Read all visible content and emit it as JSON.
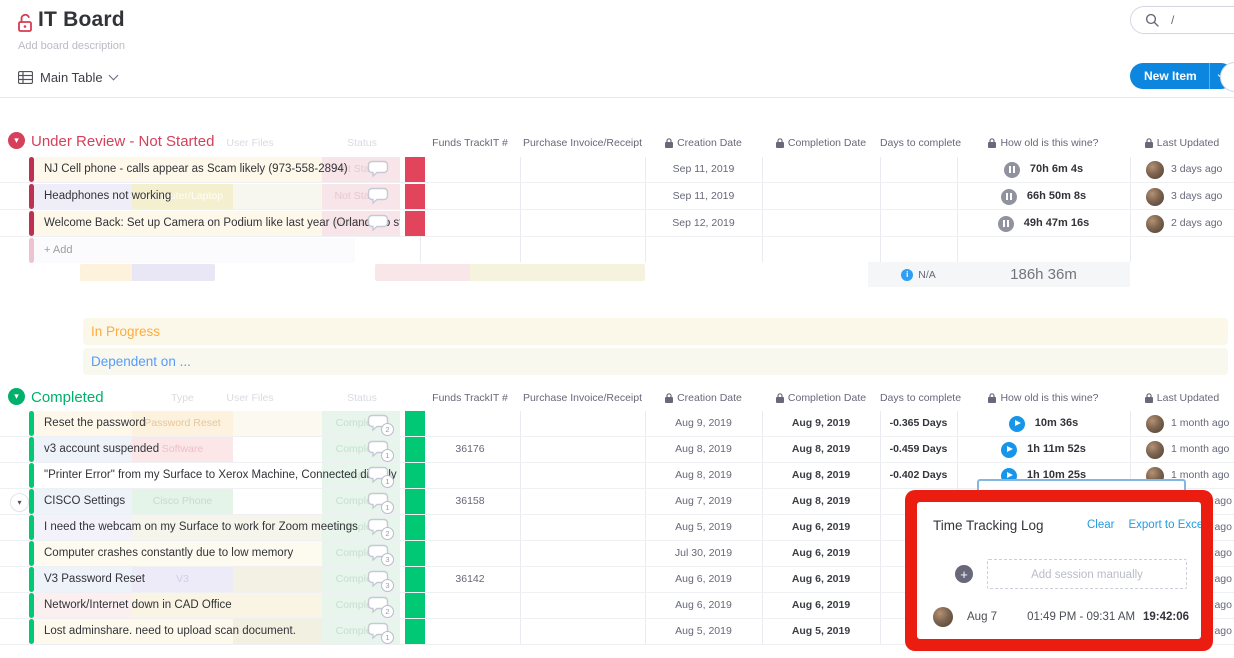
{
  "header": {
    "title": "IT Board",
    "description_placeholder": "Add board description",
    "view_tab": "Main Table",
    "new_item_label": "New Item",
    "search_shortcut": "/"
  },
  "columns": {
    "type": "Type",
    "user_files": "User Files",
    "status": "Status",
    "funds": "Funds TrackIT #",
    "purchase": "Purchase Invoice/Receipt",
    "creation": "Creation Date",
    "completion": "Completion Date",
    "days": "Days to complete",
    "wine": "How old is this wine?",
    "last_updated": "Last Updated"
  },
  "groups": [
    {
      "title": "Under Review - Not Started",
      "add_label": "+ Add",
      "rows": [
        {
          "name": "NJ Cell phone - calls appear as Scam likely (973-558-2894)",
          "status": "Not Started",
          "creation": "Sep 11, 2019",
          "wine": "70h 6m 4s",
          "updated": "3 days ago"
        },
        {
          "name": "Headphones not working",
          "type": "Computer/Laptop",
          "status": "Not Started",
          "creation": "Sep 11, 2019",
          "wine": "66h 50m 8s",
          "updated": "3 days ago"
        },
        {
          "name": "Welcome Back: Set up Camera on Podium like last year (Orlando to stay in Au...",
          "status": "Not Started",
          "creation": "Sep 12, 2019",
          "wine": "49h 47m 16s",
          "updated": "2 days ago"
        }
      ],
      "summary": {
        "days_value": "N/A",
        "wine_total": "186h 36m"
      }
    },
    {
      "title": "In Progress",
      "collapsed": true
    },
    {
      "title": "Dependent on ...",
      "collapsed": true
    },
    {
      "title": "Completed",
      "rows": [
        {
          "name": "Reset the password",
          "type": "Password Reset",
          "status": "Completed",
          "creation": "Aug 9, 2019",
          "completion": "Aug 9, 2019",
          "days": "-0.365 Days",
          "wine": "10m 36s",
          "updated": "1 month ago",
          "comments": "2"
        },
        {
          "name": "v3 account suspended",
          "type": "Software",
          "status": "Completed",
          "funds": "36176",
          "creation": "Aug 8, 2019",
          "completion": "Aug 8, 2019",
          "days": "-0.459 Days",
          "wine": "1h 11m 52s",
          "updated": "1 month ago",
          "comments": "1"
        },
        {
          "name": "\"Printer Error\" from my Surface to Xerox Machine, Connected directly to netw...",
          "status": "Completed",
          "creation": "Aug 8, 2019",
          "completion": "Aug 8, 2019",
          "days": "-0.402 Days",
          "wine": "1h 10m 25s",
          "updated": "1 month ago",
          "comments": "1"
        },
        {
          "name": "CISCO Settings",
          "type": "Cisco Phone",
          "status": "Completed",
          "funds": "36158",
          "creation": "Aug 7, 2019",
          "completion": "Aug 8, 2019",
          "updated": "ago",
          "comments": "1"
        },
        {
          "name": "I need the webcam on my Surface to work for Zoom meetings",
          "status": "Completed",
          "creation": "Aug 5, 2019",
          "completion": "Aug 6, 2019",
          "updated": "ago",
          "comments": "2"
        },
        {
          "name": "Computer crashes constantly due to low memory",
          "status": "Completed",
          "creation": "Jul 30, 2019",
          "completion": "Aug 6, 2019",
          "updated": "ago",
          "comments": "3"
        },
        {
          "name": "V3 Password Reset",
          "type": "V3",
          "status": "Completed",
          "funds": "36142",
          "creation": "Aug 6, 2019",
          "completion": "Aug 6, 2019",
          "updated": "ago",
          "comments": "3"
        },
        {
          "name": "Network/Internet down in CAD Office",
          "status": "Completed",
          "creation": "Aug 6, 2019",
          "completion": "Aug 6, 2019",
          "updated": "ago",
          "comments": "2"
        },
        {
          "name": "Lost adminshare. need to upload scan document.",
          "status": "Completed",
          "creation": "Aug 5, 2019",
          "completion": "Aug 5, 2019",
          "updated": "ago",
          "comments": "1"
        }
      ]
    }
  ],
  "time_tracking_popup": {
    "title": "Time Tracking Log",
    "clear_label": "Clear",
    "export_label": "Export to Excel",
    "add_placeholder": "Add session manually",
    "session": {
      "date": "Aug 7",
      "range": "01:49 PM - 09:31 AM",
      "duration": "19:42:06"
    }
  },
  "colors": {
    "accent_blue": "#0c86df",
    "link_blue": "#1f9ce4",
    "group_red": "#d6405a",
    "group_orange": "#fdab3d",
    "group_blue": "#579bfc",
    "group_green": "#00b06b",
    "status_red": "#e2445c",
    "status_green": "#00c875",
    "annotation_red": "#ea1d10"
  }
}
